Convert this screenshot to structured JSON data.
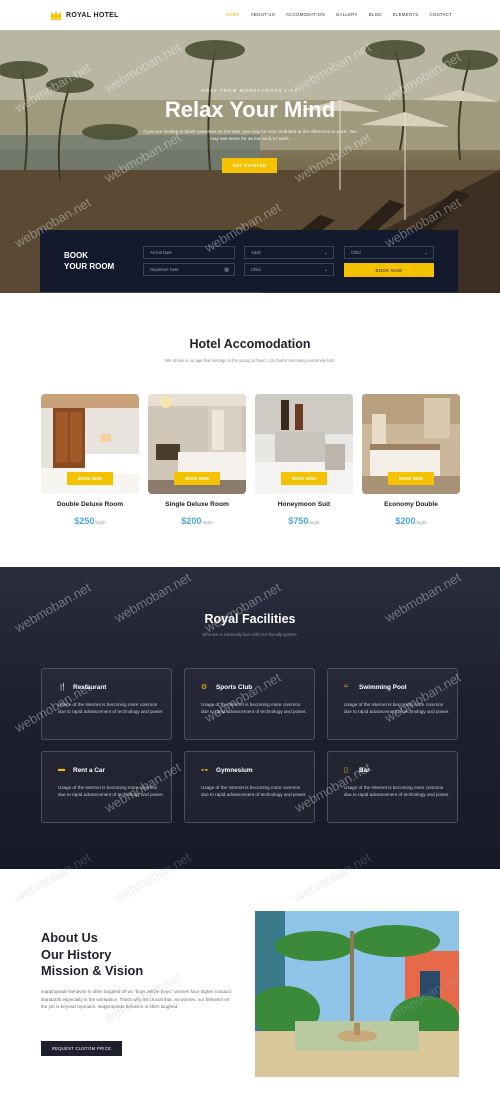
{
  "header": {
    "logo_text": "ROYAL HOTEL",
    "nav": [
      "HOME",
      "ABOUT US",
      "ACCOMODATION",
      "GALLERY",
      "BLOG",
      "ELEMENTS",
      "CONTACT"
    ],
    "active_nav": "HOME"
  },
  "hero": {
    "subtitle": "AWAY FROM MONOTONOUS LIFE",
    "title": "Relax Your Mind",
    "description": "If you are looking at blank cassettes on the web, you may be very confused at the difference in price. You may see some for as low as $.17 each.",
    "cta": "GET STARTED"
  },
  "booking": {
    "title_line1": "BOOK",
    "title_line2": "YOUR ROOM",
    "arrival_placeholder": "Arrival Date",
    "departure_placeholder": "Departure Date",
    "adult_placeholder": "Adult",
    "child_placeholder": "Child",
    "child2_placeholder": "Child",
    "button": "BOOK NOW"
  },
  "accommodation": {
    "title": "Hotel Accomodation",
    "subtitle": "We all live in an age that belongs to the young at heart. Life that is becoming extremely fast,",
    "book_label": "BOOK NOW",
    "per_label": "/night",
    "rooms": [
      {
        "name": "Double Deluxe Room",
        "price": "$250"
      },
      {
        "name": "Single Deluxe Room",
        "price": "$200"
      },
      {
        "name": "Honeymoon Suit",
        "price": "$750"
      },
      {
        "name": "Economy Double",
        "price": "$200"
      }
    ]
  },
  "facilities": {
    "title": "Royal Facilities",
    "subtitle": "Who are in extremely love with eco friendly system.",
    "items": [
      {
        "title": "Restaurant",
        "desc": "Usage of the Internet is becoming more common due to rapid advancement of technology and power.",
        "icon": "restaurant-icon"
      },
      {
        "title": "Sports Club",
        "desc": "Usage of the Internet is becoming more common due to rapid advancement of technology and power.",
        "icon": "bicycle-icon"
      },
      {
        "title": "Swimming Pool",
        "desc": "Usage of the Internet is becoming more common due to rapid advancement of technology and power.",
        "icon": "pool-icon"
      },
      {
        "title": "Rent a Car",
        "desc": "Usage of the Internet is becoming more common due to rapid advancement of technology and power.",
        "icon": "car-icon"
      },
      {
        "title": "Gymnesium",
        "desc": "Usage of the Internet is becoming more common due to rapid advancement of technology and power.",
        "icon": "dumbbell-icon"
      },
      {
        "title": "Bar",
        "desc": "Usage of the Internet is becoming more common due to rapid advancement of technology and power.",
        "icon": "bar-icon"
      }
    ]
  },
  "about": {
    "title_line1": "About Us",
    "title_line2": "Our History",
    "title_line3": "Mission & Vision",
    "description": "inappropriate behavior is often laughed off as \"boys will be boys,\" women face higher conduct standards especially in the workplace. That's why it's crucial that, as women, our behavior on the job is beyond reproach. inappropriate behavior is often laughed.",
    "button": "REQUEST CUSTOM PRICE"
  },
  "watermark": "webmoban.net",
  "colors": {
    "accent": "#f5c200",
    "dark": "#1f1f2e",
    "price": "#4fa3e0"
  }
}
